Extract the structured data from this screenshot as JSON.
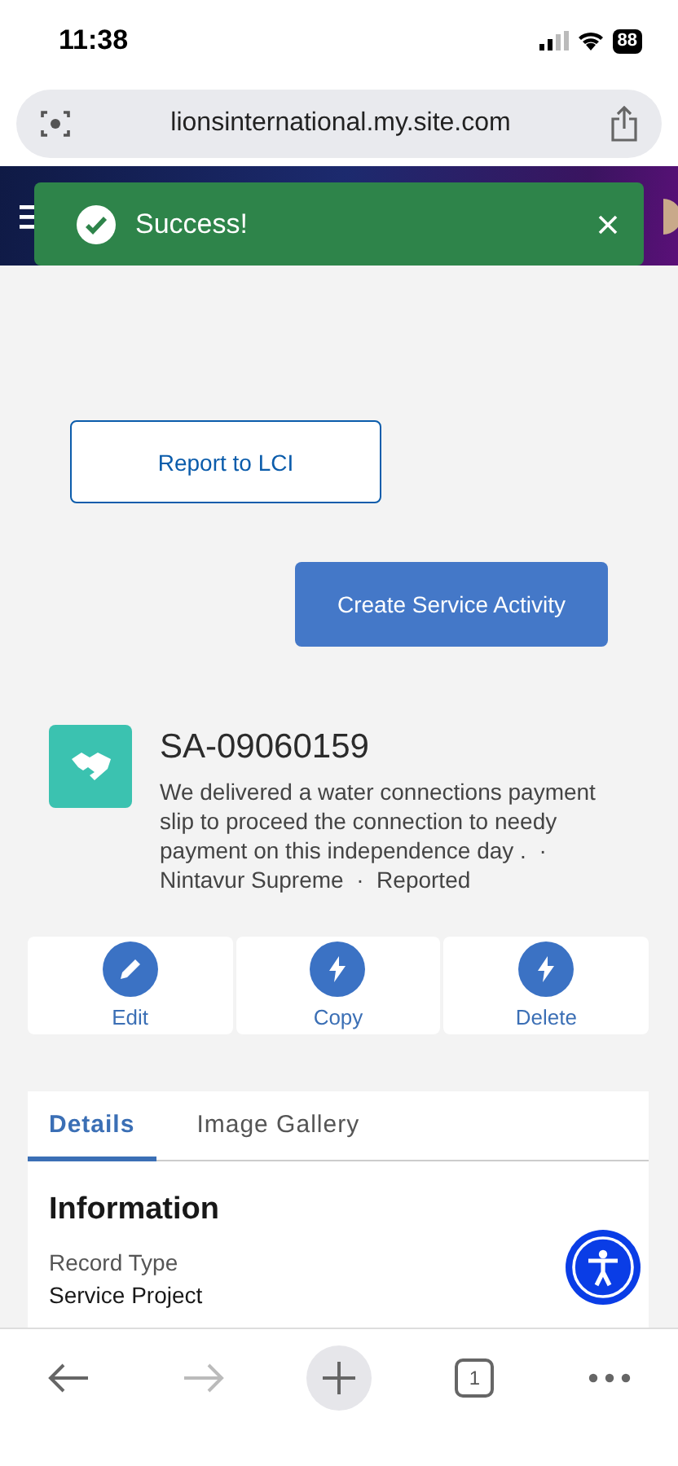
{
  "status_bar": {
    "time": "11:38",
    "battery": "88"
  },
  "browser": {
    "url": "lionsinternational.my.site.com",
    "tab_count": "1"
  },
  "toast": {
    "message": "Success!"
  },
  "buttons": [
    {
      "label": "Report to LCI",
      "kind": "outline"
    },
    {
      "label": "Create Service Activity",
      "kind": "brand"
    }
  ],
  "record": {
    "title": "SA-09060159",
    "description": "We delivered a water connections payment slip to proceed the connection to needy payment on this independence day .  ·  Nintavur Supreme  ·  Reported"
  },
  "actions": [
    {
      "label": "Edit",
      "kind": "edit"
    },
    {
      "label": "Copy",
      "kind": "bolt"
    },
    {
      "label": "Delete",
      "kind": "bolt"
    }
  ],
  "tabs": [
    {
      "label": "Details",
      "selected": true
    },
    {
      "label": "Image Gallery",
      "selected": false
    }
  ],
  "section": {
    "title": "Information",
    "fields": [
      {
        "label": "Record Type",
        "value": "Service Project"
      }
    ]
  }
}
